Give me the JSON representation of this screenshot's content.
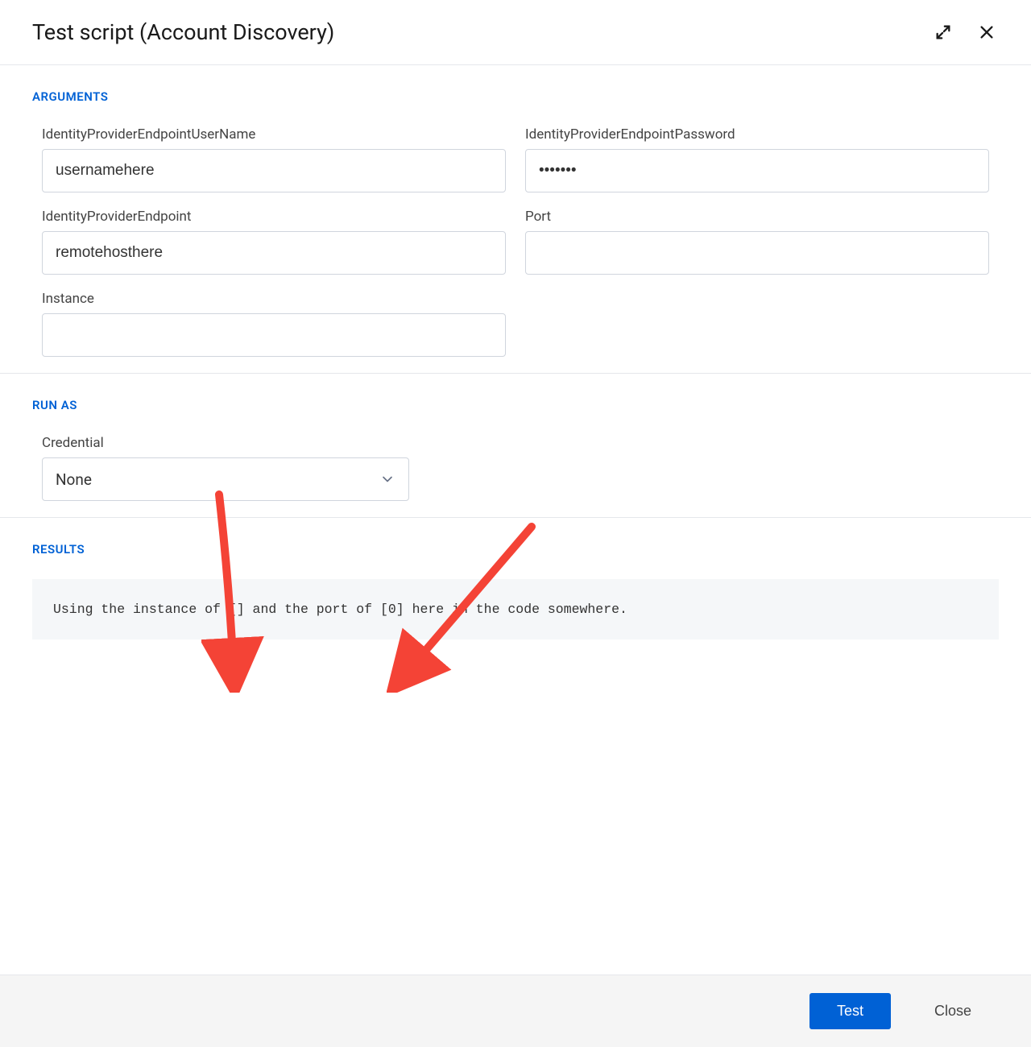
{
  "dialog": {
    "title": "Test script (Account Discovery)"
  },
  "sections": {
    "arguments": {
      "title": "ARGUMENTS",
      "fields": {
        "username_label": "IdentityProviderEndpointUserName",
        "username_value": "usernamehere",
        "password_label": "IdentityProviderEndpointPassword",
        "password_value": "•••••••",
        "endpoint_label": "IdentityProviderEndpoint",
        "endpoint_value": "remotehosthere",
        "port_label": "Port",
        "port_value": "",
        "instance_label": "Instance",
        "instance_value": ""
      }
    },
    "runas": {
      "title": "RUN AS",
      "credential_label": "Credential",
      "credential_value": "None"
    },
    "results": {
      "title": "RESULTS",
      "output": "Using the instance of [] and the port of [0] here in the code somewhere."
    }
  },
  "footer": {
    "test_label": "Test",
    "close_label": "Close"
  }
}
